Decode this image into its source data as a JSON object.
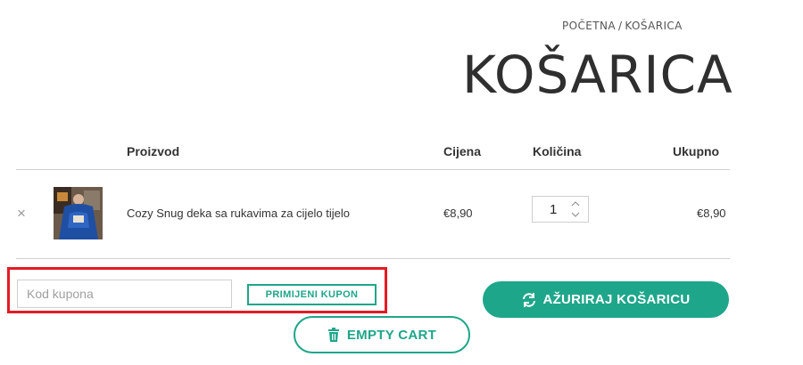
{
  "breadcrumb": {
    "home": "POČETNA",
    "separator": "/",
    "current": "KOŠARICA"
  },
  "page_title": "KOŠARICA",
  "table": {
    "headers": {
      "product": "Proizvod",
      "price": "Cijena",
      "quantity": "Količina",
      "total": "Ukupno"
    },
    "rows": [
      {
        "name": "Cozy Snug deka sa rukavima za cijelo tijelo",
        "price": "€8,90",
        "quantity": "1",
        "total": "€8,90",
        "remove": "×"
      }
    ]
  },
  "coupon": {
    "placeholder": "Kod kupona",
    "value": "",
    "apply_label": "PRIMIJENI KUPON"
  },
  "actions": {
    "update_label": "AŽURIRAJ KOŠARICU",
    "empty_label": "EMPTY CART"
  },
  "colors": {
    "accent": "#1ea68a",
    "highlight": "#e31b23",
    "divider": "#cfcfcf"
  },
  "icons": {
    "remove": "close-icon",
    "update": "refresh-icon",
    "empty": "trash-icon",
    "qty": "spinner-arrows-icon"
  }
}
